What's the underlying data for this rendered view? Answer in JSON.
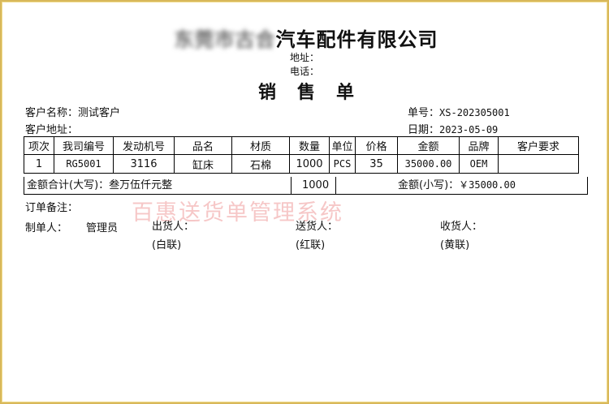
{
  "company": {
    "name_blurred": "东莞市古合",
    "name_suffix": "汽车配件有限公司"
  },
  "address_label": "地址：",
  "phone_label": "电话：",
  "doc_title": "销售单",
  "customer_name": {
    "label": "客户名称：",
    "value": "测试客户"
  },
  "customer_address": {
    "label": "客户地址：",
    "value": ""
  },
  "order_no": {
    "label": "单号：",
    "value": "XS-202305001"
  },
  "date": {
    "label": "日期：",
    "value": "2023-05-09"
  },
  "table": {
    "headers": [
      "项次",
      "我司编号",
      "发动机号",
      "品名",
      "材质",
      "数量",
      "单位",
      "价格",
      "金额",
      "品牌",
      "客户要求"
    ],
    "rows": [
      [
        "1",
        "RG5001",
        "3116",
        "缸床",
        "石棉",
        "1000",
        "PCS",
        "35",
        "35000.00",
        "OEM",
        ""
      ]
    ]
  },
  "totals": {
    "upper_label": "金额合计(大写)：",
    "upper_value": "叁万伍仟元整",
    "quantity": "1000",
    "lower_label": "金额(小写)：",
    "lower_value": "￥35000.00"
  },
  "order_note_label": "订单备注：",
  "signatures": {
    "maker_label": "制单人：",
    "maker_value": "管理员",
    "shipper_label": "出货人：",
    "shipper_copy": "(白联)",
    "deliverer_label": "送货人：",
    "deliverer_copy": "(红联)",
    "receiver_label": "收货人：",
    "receiver_copy": "(黄联)"
  },
  "watermark": "百惠送货单管理系统"
}
